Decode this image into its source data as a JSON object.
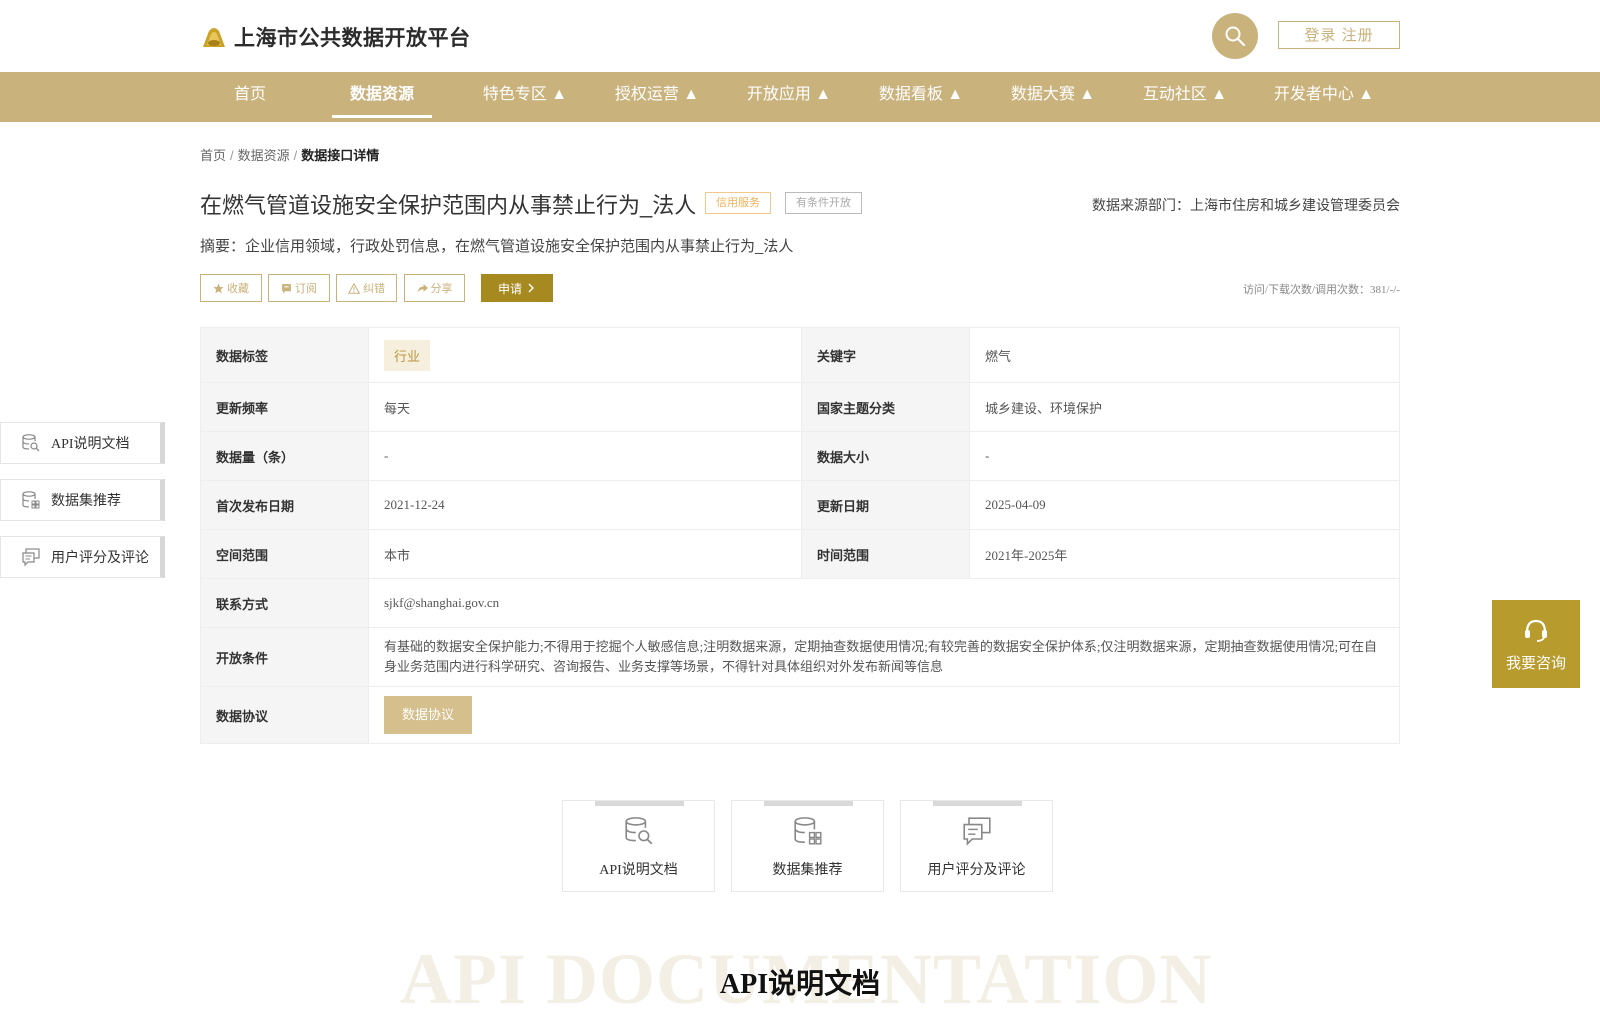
{
  "header": {
    "site_title": "上海市公共数据开放平台",
    "login_label": "登录 注册"
  },
  "nav": {
    "items": [
      {
        "label": "首页"
      },
      {
        "label": "数据资源"
      },
      {
        "label": "特色专区 ▲"
      },
      {
        "label": "授权运营 ▲"
      },
      {
        "label": "开放应用 ▲"
      },
      {
        "label": "数据看板 ▲"
      },
      {
        "label": "数据大赛 ▲"
      },
      {
        "label": "互动社区 ▲"
      },
      {
        "label": "开发者中心 ▲"
      }
    ],
    "active_index": 1
  },
  "breadcrumb": {
    "home": "首页",
    "section": "数据资源",
    "current": "数据接口详情"
  },
  "detail": {
    "title": "在燃气管道设施安全保护范围内从事禁止行为_法人",
    "tag_credit": "信用服务",
    "tag_condition": "有条件开放",
    "source": "数据来源部门：上海市住房和城乡建设管理委员会",
    "summary": "摘要：企业信用领域，行政处罚信息，在燃气管道设施安全保护范围内从事禁止行为_法人"
  },
  "actions": {
    "favorite": "收藏",
    "subscribe": "订阅",
    "report": "纠错",
    "share": "分享",
    "apply": "申请",
    "stats": "访问/下载次数/调用次数：381/-/-"
  },
  "info": {
    "data_tag_label": "数据标签",
    "data_tag_value": "行业",
    "keyword_label": "关键字",
    "keyword_value": "燃气",
    "freq_label": "更新频率",
    "freq_value": "每天",
    "theme_label": "国家主题分类",
    "theme_value": "城乡建设、环境保护",
    "count_label": "数据量（条）",
    "count_value": "-",
    "size_label": "数据大小",
    "size_value": "-",
    "first_pub_label": "首次发布日期",
    "first_pub_value": "2021-12-24",
    "update_label": "更新日期",
    "update_value": "2025-04-09",
    "space_label": "空间范围",
    "space_value": "本市",
    "time_label": "时间范围",
    "time_value": "2021年-2025年",
    "contact_label": "联系方式",
    "contact_value": "sjkf@shanghai.gov.cn",
    "open_cond_label": "开放条件",
    "open_cond_value": "有基础的数据安全保护能力;不得用于挖掘个人敏感信息;注明数据来源，定期抽查数据使用情况;有较完善的数据安全保护体系;仅注明数据来源，定期抽查数据使用情况;可在自身业务范围内进行科学研究、咨询报告、业务支撑等场景，不得针对具体组织对外发布新闻等信息",
    "agreement_label": "数据协议",
    "agreement_button": "数据协议"
  },
  "side_nav": [
    {
      "label": "API说明文档",
      "icon": "doc-search-icon"
    },
    {
      "label": "数据集推荐",
      "icon": "database-grid-icon"
    },
    {
      "label": "用户评分及评论",
      "icon": "comment-icon"
    }
  ],
  "consult": {
    "label": "我要咨询",
    "icon": "headset-icon"
  },
  "cards": [
    {
      "label": "API说明文档",
      "icon": "doc-search-icon"
    },
    {
      "label": "数据集推荐",
      "icon": "database-grid-icon"
    },
    {
      "label": "用户评分及评论",
      "icon": "comment-icon"
    }
  ],
  "section": {
    "bg_text": "API DOCUMENTATION",
    "heading": "API说明文档"
  },
  "colors": {
    "brand": "#c9b27c",
    "apply": "#a68a1f",
    "consult": "#b89b2d"
  }
}
